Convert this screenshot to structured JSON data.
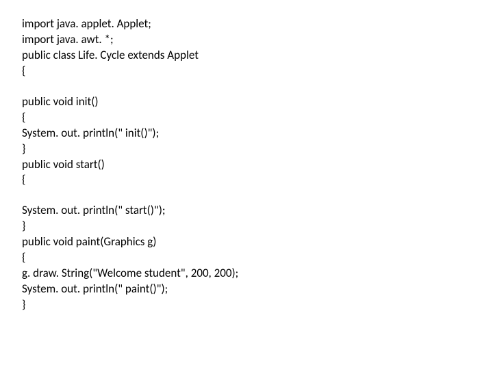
{
  "code": {
    "l1": "import java. applet. Applet;",
    "l2": "import java. awt. *;",
    "l3": "public class Life. Cycle extends Applet",
    "l4": "{",
    "l5": "public void init()",
    "l6": "{",
    "l7": "System. out. println(\" init()\");",
    "l8": "}",
    "l9": "public void start()",
    "l10": "{",
    "l11": "System. out. println(\" start()\");",
    "l12": "}",
    "l13": "public void paint(Graphics g)",
    "l14": "{",
    "l15": "g. draw. String(\"Welcome student\", 200, 200);",
    "l16": "System. out. println(\" paint()\");",
    "l17": "}"
  }
}
